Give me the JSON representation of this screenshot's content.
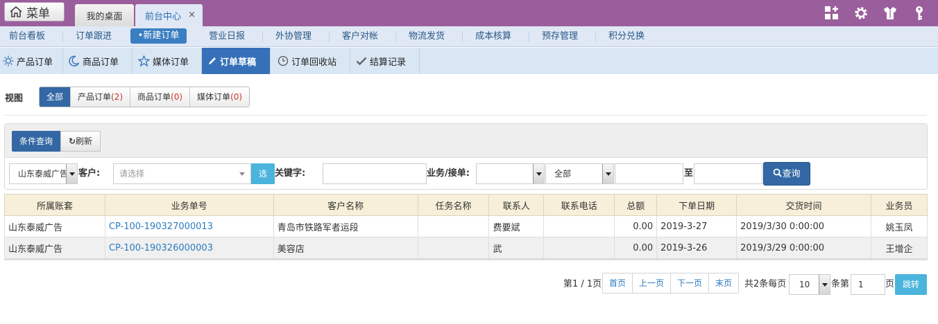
{
  "topbar": {
    "menu_label": "菜单",
    "tabs": [
      {
        "label": "我的桌面"
      },
      {
        "label": "前台中心",
        "close": "×"
      }
    ],
    "icons": [
      "dashboard-add-icon",
      "gear-icon",
      "shirt-icon",
      "key-icon"
    ]
  },
  "nav2": {
    "items": [
      "前台看板",
      "订单跟进",
      "•新建订单",
      "营业日报",
      "外协管理",
      "客户对帐",
      "物流发货",
      "成本核算",
      "预存管理",
      "积分兑换"
    ],
    "active_index": 2
  },
  "nav3": {
    "tabs": [
      {
        "label": "产品订单",
        "icon": "sun-icon"
      },
      {
        "label": "商品订单",
        "icon": "moon-icon"
      },
      {
        "label": "媒体订单",
        "icon": "star-icon"
      },
      {
        "label": "订单草稿",
        "icon": "pencil-icon"
      },
      {
        "label": "订单回收站",
        "icon": "clock-icon"
      },
      {
        "label": "结算记录",
        "icon": "check-icon"
      }
    ],
    "active_index": 3
  },
  "view": {
    "label": "视图",
    "buttons": [
      {
        "label": "全部",
        "count": ""
      },
      {
        "label": "产品订单",
        "count": "(2)"
      },
      {
        "label": "商品订单",
        "count": "(0)"
      },
      {
        "label": "媒体订单",
        "count": "(0)"
      }
    ]
  },
  "query": {
    "cond_label": "条件查询",
    "refresh_label": "刷新",
    "account_value": "山东泰威广告",
    "customer_label": "客户:",
    "customer_placeholder": "请选择",
    "select_label": "选",
    "keyword_label": "关键字:",
    "business_label": "业务/接单:",
    "business_value": "",
    "scope_value": "全部",
    "to_label": "至",
    "search_label": "查询"
  },
  "table": {
    "columns": [
      "所属账套",
      "业务单号",
      "客户名称",
      "任务名称",
      "联系人",
      "联系电话",
      "总额",
      "下单日期",
      "交货时间",
      "业务员"
    ],
    "rows": [
      [
        "山东泰威广告",
        "CP-100-190327000013",
        "青岛市铁路军者运段",
        "",
        "费要斌",
        "",
        "0.00",
        "2019-3-27",
        "2019/3/30 0:00:00",
        "姚玉凤"
      ],
      [
        "山东泰威广告",
        "CP-100-190326000003",
        "美容店",
        "",
        "武",
        "",
        "0.00",
        "2019-3-26",
        "2019/3/29 0:00:00",
        "王增企"
      ]
    ]
  },
  "pager": {
    "page_info": "第1 / 1页",
    "first": "首页",
    "prev": "上一页",
    "next": "下一页",
    "last": "末页",
    "total_text": "共2条每页",
    "page_size": "10",
    "goto_prefix": "条第",
    "goto_value": "1",
    "goto_suffix": "页",
    "go_label": "跳转"
  },
  "colors": {
    "topbar": "#9a5e9c",
    "primary": "#3368a4",
    "accent": "#4ab4dc",
    "link": "#2a7bc0",
    "header_bg": "#f7efd9"
  }
}
